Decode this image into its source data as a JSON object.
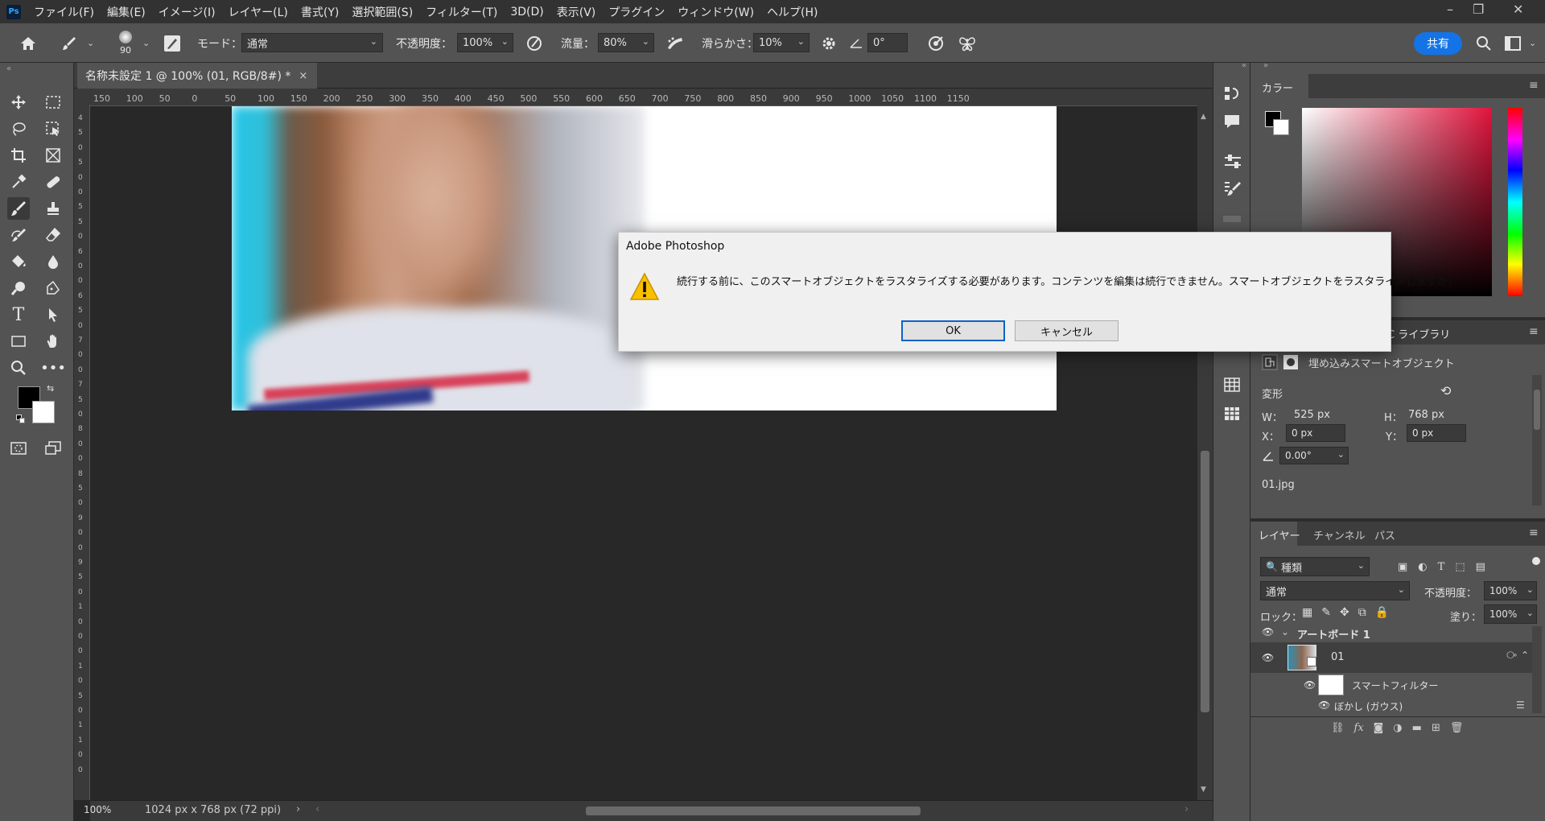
{
  "app": {
    "logo": "Ps",
    "accent": "#1473e6"
  },
  "menu": [
    "ファイル(F)",
    "編集(E)",
    "イメージ(I)",
    "レイヤー(L)",
    "書式(Y)",
    "選択範囲(S)",
    "フィルター(T)",
    "3D(D)",
    "表示(V)",
    "プラグイン",
    "ウィンドウ(W)",
    "ヘルプ(H)"
  ],
  "window_controls": {
    "minimize": "–",
    "restore": "❐",
    "close": "✕"
  },
  "options": {
    "brush_size": "90",
    "mode_label": "モード：",
    "mode_value": "通常",
    "opacity_label": "不透明度：",
    "opacity_value": "100%",
    "flow_label": "流量：",
    "flow_value": "80%",
    "smoothing_label": "滑らかさ：",
    "smoothing_value": "10%",
    "angle_value": "0°",
    "share_label": "共有"
  },
  "document": {
    "tab_title": "名称未設定 1 @ 100% (01, RGB/8#) *",
    "tab_close": "×",
    "zoom": "100%",
    "doc_info": "1024 px x 768 px (72 ppi)",
    "ruler_h": [
      "150",
      "100",
      "50",
      "0",
      "50",
      "100",
      "150",
      "200",
      "250",
      "300",
      "350",
      "400",
      "450",
      "500",
      "550",
      "600",
      "650",
      "700",
      "750",
      "800",
      "850",
      "900",
      "950",
      "1000",
      "1050",
      "1100",
      "1150"
    ],
    "ruler_v": [
      "4",
      "5",
      "0",
      "5",
      "0",
      "0",
      "5",
      "5",
      "0",
      "6",
      "0",
      "0",
      "6",
      "5",
      "0",
      "7",
      "0",
      "0",
      "7",
      "5",
      "0",
      "8",
      "0",
      "0",
      "8",
      "5",
      "0",
      "9",
      "0",
      "0",
      "9",
      "5",
      "0",
      "1",
      "0",
      "0",
      "0",
      "1",
      "0",
      "5",
      "0",
      "1",
      "1",
      "0",
      "0"
    ]
  },
  "panels": {
    "color_tab": "カラー",
    "libraries_tab": "C ライブラリ",
    "properties": {
      "type": "埋め込みスマートオブジェクト",
      "transform": "変形",
      "w_label": "W：",
      "w_value": "525 px",
      "h_label": "H：",
      "h_value": "768 px",
      "x_label": "X：",
      "x_value": "0 px",
      "y_label": "Y：",
      "y_value": "0 px",
      "angle": "0.00°",
      "file": "01.jpg"
    },
    "layers": {
      "tabs": [
        "レイヤー",
        "チャンネル",
        "パス"
      ],
      "filter_kind": "種類",
      "blend_mode": "通常",
      "opacity_label": "不透明度：",
      "opacity_value": "100%",
      "lock_label": "ロック：",
      "fill_label": "塗り：",
      "fill_value": "100%",
      "artboard": "アートボード 1",
      "layer_name": "01",
      "smart_filter": "スマートフィルター",
      "blur_filter": "ぼかし (ガウス)"
    }
  },
  "dialog": {
    "title": "Adobe Photoshop",
    "message": "続行する前に、このスマートオブジェクトをラスタライズする必要があります。コンテンツを編集は続行できません。スマートオブジェクトをラスタライズしますか？",
    "ok_label": "OK",
    "cancel_label": "キャンセル"
  }
}
